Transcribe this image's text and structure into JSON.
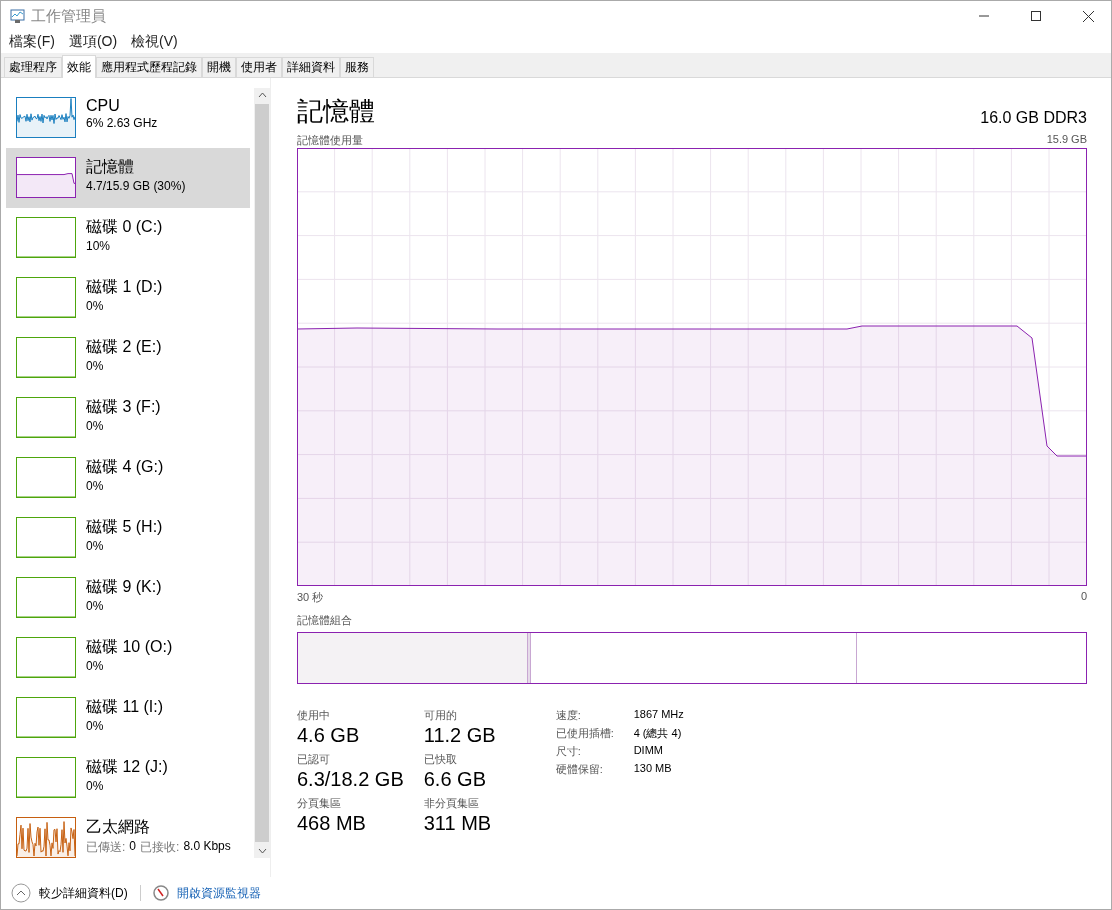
{
  "window": {
    "title": "工作管理員"
  },
  "menu": [
    "檔案(F)",
    "選項(O)",
    "檢視(V)"
  ],
  "tabs": [
    {
      "label": "處理程序",
      "selected": false
    },
    {
      "label": "效能",
      "selected": true
    },
    {
      "label": "應用程式歷程記錄",
      "selected": false
    },
    {
      "label": "開機",
      "selected": false
    },
    {
      "label": "使用者",
      "selected": false
    },
    {
      "label": "詳細資料",
      "selected": false
    },
    {
      "label": "服務",
      "selected": false
    }
  ],
  "sidebar": {
    "items": [
      {
        "kind": "cpu",
        "name": "CPU",
        "detail": "6%  2.63 GHz",
        "color": "#1a7fbf",
        "selected": false
      },
      {
        "kind": "memory",
        "name": "記憶體",
        "detail": "4.7/15.9 GB (30%)",
        "color": "#8b22b0",
        "selected": true
      },
      {
        "kind": "disk",
        "name": "磁碟 0 (C:)",
        "detail": "10%",
        "color": "#4da60c",
        "selected": false
      },
      {
        "kind": "disk",
        "name": "磁碟 1 (D:)",
        "detail": "0%",
        "color": "#4da60c",
        "selected": false
      },
      {
        "kind": "disk",
        "name": "磁碟 2 (E:)",
        "detail": "0%",
        "color": "#4da60c",
        "selected": false
      },
      {
        "kind": "disk",
        "name": "磁碟 3 (F:)",
        "detail": "0%",
        "color": "#4da60c",
        "selected": false
      },
      {
        "kind": "disk",
        "name": "磁碟 4 (G:)",
        "detail": "0%",
        "color": "#4da60c",
        "selected": false
      },
      {
        "kind": "disk",
        "name": "磁碟 5 (H:)",
        "detail": "0%",
        "color": "#4da60c",
        "selected": false
      },
      {
        "kind": "disk",
        "name": "磁碟 9 (K:)",
        "detail": "0%",
        "color": "#4da60c",
        "selected": false
      },
      {
        "kind": "disk",
        "name": "磁碟 10 (O:)",
        "detail": "0%",
        "color": "#4da60c",
        "selected": false
      },
      {
        "kind": "disk",
        "name": "磁碟 11 (I:)",
        "detail": "0%",
        "color": "#4da60c",
        "selected": false
      },
      {
        "kind": "disk",
        "name": "磁碟 12 (J:)",
        "detail": "0%",
        "color": "#4da60c",
        "selected": false
      },
      {
        "kind": "network",
        "name": "乙太網路",
        "sent_label": "已傳送:",
        "sent": "0",
        "received_label": "已接收:",
        "received": "8.0 Kbps",
        "color": "#c65f10",
        "selected": false
      }
    ]
  },
  "panel": {
    "title": "記憶體",
    "subtitle": "16.0 GB DDR3",
    "graph_label": "記憶體使用量",
    "graph_max": "15.9 GB",
    "graph_start": "30 秒",
    "graph_end": "0",
    "composition_label": "記憶體組合",
    "composition": {
      "level": 0.292
    },
    "stats": [
      {
        "label": "使用中",
        "value": "4.6 GB"
      },
      {
        "label": "可用的",
        "value": "11.2 GB"
      },
      {
        "label": "已認可",
        "value": "6.3/18.2 GB"
      },
      {
        "label": "已快取",
        "value": "6.6 GB"
      },
      {
        "label": "分頁集區",
        "value": "468 MB"
      },
      {
        "label": "非分頁集區",
        "value": "311 MB"
      }
    ],
    "properties": [
      {
        "label": "速度:",
        "value": "1867 MHz"
      },
      {
        "label": "已使用插槽:",
        "value": "4 (總共 4)"
      },
      {
        "label": "尺寸:",
        "value": "DIMM"
      },
      {
        "label": "硬體保留:",
        "value": "130 MB"
      }
    ]
  },
  "footer": {
    "fewer_details": "較少詳細資料(D)",
    "resource_monitor": "開啟資源監視器"
  }
}
